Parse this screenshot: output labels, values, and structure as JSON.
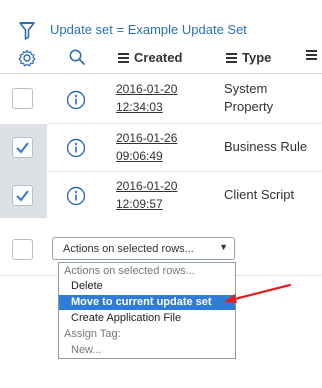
{
  "filter": {
    "text": "Update set = Example Update Set"
  },
  "header": {
    "columns": [
      {
        "label": "Created"
      },
      {
        "label": "Type"
      }
    ]
  },
  "rows": [
    {
      "selected": false,
      "created_date": "2016-01-20",
      "created_time": "12:34:03",
      "type_line1": "System",
      "type_line2": "Property"
    },
    {
      "selected": true,
      "created_date": "2016-01-26",
      "created_time": "09:06:49",
      "type_line1": "Business Rule",
      "type_line2": ""
    },
    {
      "selected": true,
      "created_date": "2016-01-20",
      "created_time": "12:09:57",
      "type_line1": "Client Script",
      "type_line2": ""
    }
  ],
  "actions": {
    "select_value": "Actions on selected rows...",
    "options": [
      {
        "label": "Actions on selected rows...",
        "kind": "header"
      },
      {
        "label": "Delete",
        "kind": "option"
      },
      {
        "label": "Move to current update set",
        "kind": "option",
        "highlighted": true
      },
      {
        "label": "Create Application File",
        "kind": "option"
      },
      {
        "label": "Assign Tag:",
        "kind": "header"
      },
      {
        "label": "New...",
        "kind": "option-grey"
      }
    ]
  },
  "colors": {
    "link_blue": "#2f6eb4",
    "highlight": "#2f7bd8",
    "arrow_red": "#e02020",
    "selected_bg": "#dde1e6"
  }
}
